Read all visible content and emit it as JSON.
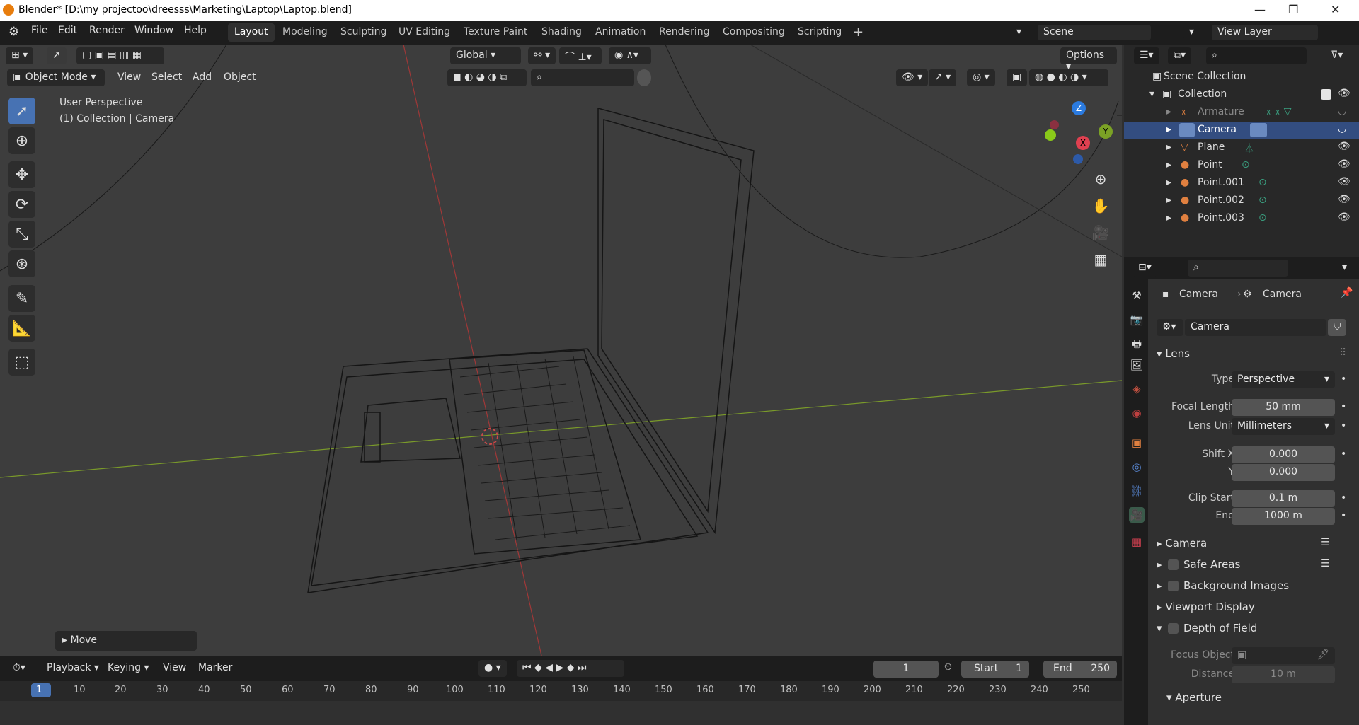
{
  "window": {
    "title": "Blender* [D:\\my projectoo\\dreesss\\Marketing\\Laptop\\Laptop.blend]",
    "minimize": "—",
    "maximize": "❐",
    "close": "✕"
  },
  "menus": [
    "File",
    "Edit",
    "Render",
    "Window",
    "Help"
  ],
  "workspaces": [
    "Layout",
    "Modeling",
    "Sculpting",
    "UV Editing",
    "Texture Paint",
    "Shading",
    "Animation",
    "Rendering",
    "Compositing",
    "Scripting"
  ],
  "scene": "Scene",
  "view_layer": "View Layer",
  "viewport": {
    "transform_orientation": "Global",
    "options": "Options",
    "mode": "Object Mode",
    "menus": [
      "View",
      "Select",
      "Add",
      "Object"
    ],
    "info_line1": "User Perspective",
    "info_line2": "(1) Collection | Camera",
    "last_op": "Move",
    "gizmo": {
      "z": "Z",
      "y": "Y",
      "x": "X"
    }
  },
  "outliner": {
    "scene_collection": "Scene Collection",
    "collection": "Collection",
    "items": [
      "Armature",
      "Camera",
      "Plane",
      "Point",
      "Point.001",
      "Point.002",
      "Point.003"
    ]
  },
  "properties": {
    "breadcrumb_obj": "Camera",
    "breadcrumb_data": "Camera",
    "data_name": "Camera",
    "lens_section": "Lens",
    "type_label": "Type",
    "type_value": "Perspective",
    "focal_label": "Focal Length",
    "focal_value": "50 mm",
    "lens_unit_label": "Lens Unit",
    "lens_unit_value": "Millimeters",
    "shiftx_label": "Shift X",
    "shiftx_value": "0.000",
    "shifty_label": "Y",
    "shifty_value": "0.000",
    "clip_start_label": "Clip Start",
    "clip_start_value": "0.1 m",
    "clip_end_label": "End",
    "clip_end_value": "1000 m",
    "sections": [
      "Camera",
      "Safe Areas",
      "Background Images",
      "Viewport Display",
      "Depth of Field"
    ],
    "focus_object_label": "Focus Object",
    "distance_label": "Distance",
    "distance_value": "10 m",
    "aperture": "Aperture"
  },
  "timeline": {
    "menus": [
      "Playback",
      "Keying",
      "View",
      "Marker"
    ],
    "current_frame": "1",
    "start_label": "Start",
    "start_value": "1",
    "end_label": "End",
    "end_value": "250",
    "frames": [
      "1",
      "10",
      "20",
      "30",
      "40",
      "50",
      "60",
      "70",
      "80",
      "90",
      "100",
      "110",
      "120",
      "130",
      "140",
      "150",
      "160",
      "170",
      "180",
      "190",
      "200",
      "210",
      "220",
      "230",
      "240",
      "250"
    ]
  }
}
